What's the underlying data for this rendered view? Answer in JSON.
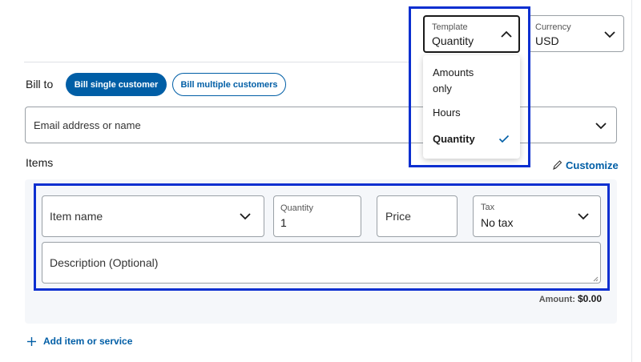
{
  "header": {
    "template": {
      "label": "Template",
      "value": "Quantity"
    },
    "currency": {
      "label": "Currency",
      "value": "USD"
    }
  },
  "template_menu": {
    "options": [
      "Amounts only",
      "Hours",
      "Quantity"
    ],
    "selected": "Quantity"
  },
  "bill_to": {
    "label": "Bill to",
    "single_button": "Bill single customer",
    "multiple_button": "Bill multiple customers",
    "email_placeholder": "Email address or name"
  },
  "items": {
    "heading": "Items",
    "customize_label": "Customize",
    "item_name_placeholder": "Item name",
    "quantity_label": "Quantity",
    "quantity_value": "1",
    "price_placeholder": "Price",
    "tax_label": "Tax",
    "tax_value": "No tax",
    "description_placeholder": "Description (Optional)",
    "amount_label": "Amount:",
    "amount_value": "$0.00",
    "add_item_label": "Add item or service"
  },
  "colors": {
    "primary": "#0070ba",
    "primary_dark": "#005ea6",
    "highlight": "#0b2fd0",
    "panel_bg": "#f5f7fa"
  }
}
